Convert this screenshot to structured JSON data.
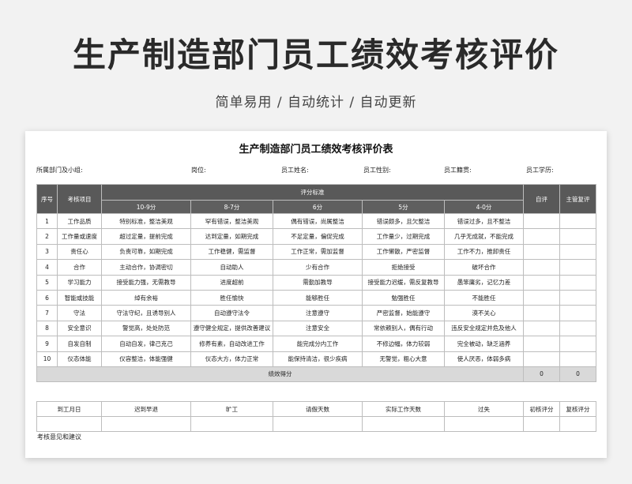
{
  "hero": {
    "title": "生产制造部门员工绩效考核评价",
    "subtitle": "简单易用 / 自动统计 / 自动更新"
  },
  "sheet": {
    "title": "生产制造部门员工绩效考核评价表",
    "meta": {
      "dept": "所属部门及小组:",
      "position": "岗位:",
      "name": "员工姓名:",
      "gender": "员工性别:",
      "origin": "员工籍贯:",
      "education": "员工学历:"
    },
    "table": {
      "headers": {
        "index": "序号",
        "item": "考核项目",
        "standard": "评分标准",
        "self": "自评",
        "manager": "主管复评",
        "bands": [
          "10-9分",
          "8-7分",
          "6分",
          "5分",
          "4-0分"
        ]
      },
      "rows": [
        {
          "n": "1",
          "item": "工作品质",
          "c": [
            "特别标准，整洁美观",
            "罕有错误，整洁美观",
            "偶有错误，尚属整洁",
            "错误颇多，且欠整洁",
            "错误过多，且不整洁"
          ]
        },
        {
          "n": "2",
          "item": "工作量或速度",
          "c": [
            "超过定量，提前完成",
            "达到定量，如期完成",
            "不足定量，偏促完成",
            "工作量少，过期完成",
            "几乎无成就，不能完成"
          ]
        },
        {
          "n": "3",
          "item": "责任心",
          "c": [
            "负责可靠，如期完成",
            "工作稳健，需监督",
            "工作正常，需加监督",
            "工作懒散，严密监督",
            "工作不力，推卸责任"
          ]
        },
        {
          "n": "4",
          "item": "合作",
          "c": [
            "主动合作，协调密切",
            "自动助人",
            "少有合作",
            "拒绝接受",
            "破坏合作"
          ]
        },
        {
          "n": "5",
          "item": "学习能力",
          "c": [
            "接受能力强，无需教导",
            "进度超前",
            "需勤加教导",
            "接受能力迟缓，需反复教导",
            "愚笨庸劣，记忆力差"
          ]
        },
        {
          "n": "6",
          "item": "智能或技能",
          "c": [
            "绰有余裕",
            "胜任愉快",
            "能够胜任",
            "勉强胜任",
            "不能胜任"
          ]
        },
        {
          "n": "7",
          "item": "守法",
          "c": [
            "守法守纪，且诱导别人",
            "自动遵守法令",
            "注意遵守",
            "严密监督，始能遵守",
            "漠不关心"
          ]
        },
        {
          "n": "8",
          "item": "安全意识",
          "c": [
            "警觉高，处处防范",
            "遵守健全规定，提供改善建议",
            "注意安全",
            "常依赖别人，偶有行动",
            "违反安全规定并危及他人"
          ]
        },
        {
          "n": "9",
          "item": "自发自制",
          "c": [
            "自动自发，律己克己",
            "修养有素，自动改进工作",
            "能完成分内工作",
            "不修边幅，体力较弱",
            "完全被动，缺乏涵养"
          ]
        },
        {
          "n": "10",
          "item": "仪态体能",
          "c": [
            "仪容整洁，体能强健",
            "仪态大方，体力正常",
            "能保持清洁，很少疾病",
            "无警觉，粗心大意",
            "使人厌恶，体弱多病"
          ]
        }
      ],
      "total": {
        "label": "绩效得分",
        "self": "0",
        "manager": "0"
      }
    },
    "attendance": {
      "headers": [
        "到工月日",
        "迟到早退",
        "旷工",
        "请假天数",
        "实际工作天数",
        "过失",
        "初核评分",
        "复核评分"
      ]
    },
    "comment_label": "考核意见和建议"
  }
}
